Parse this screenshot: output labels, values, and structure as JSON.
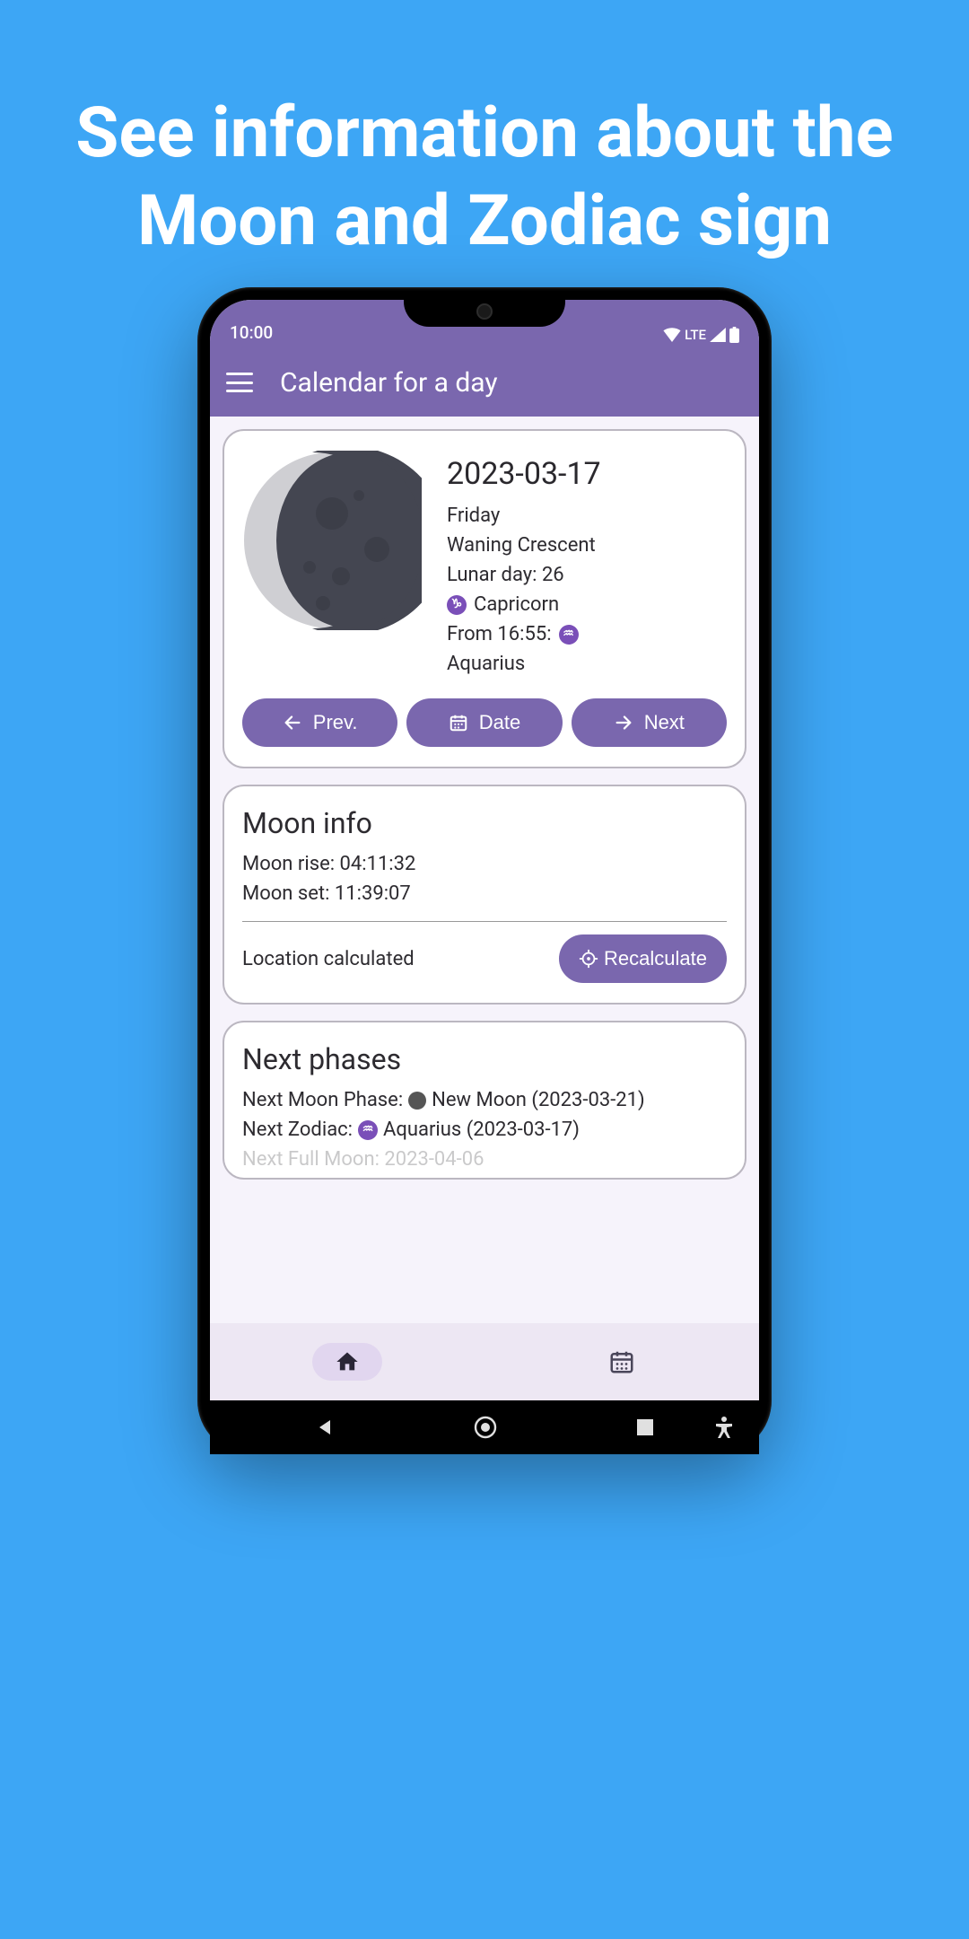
{
  "promo": {
    "title": "See information about the Moon and Zodiac sign"
  },
  "status": {
    "time": "10:00",
    "network": "LTE"
  },
  "appbar": {
    "title": "Calendar for a day"
  },
  "day": {
    "date": "2023-03-17",
    "weekday": "Friday",
    "phase": "Waning Crescent",
    "lunar_day_label": "Lunar day: 26",
    "zodiac_icon": "capricorn-icon",
    "zodiac_name": "Capricorn",
    "from_label": "From 16:55:",
    "from_zodiac_icon": "aquarius-icon",
    "from_zodiac_name": "Aquarius"
  },
  "buttons": {
    "prev": "Prev.",
    "date": "Date",
    "next": "Next",
    "recalculate": "Recalculate"
  },
  "moon_info": {
    "title": "Moon info",
    "rise": "Moon rise: 04:11:32",
    "set": "Moon set: 11:39:07",
    "location": "Location calculated"
  },
  "next_phases": {
    "title": "Next phases",
    "phase_line_pre": "Next Moon Phase: ",
    "phase_line_mid": " New Moon (2023-03-21)",
    "zodiac_line_pre": "Next Zodiac: ",
    "zodiac_line_post": " Aquarius (2023-03-17)",
    "full_moon_line": "Next Full Moon: 2023-04-06"
  }
}
